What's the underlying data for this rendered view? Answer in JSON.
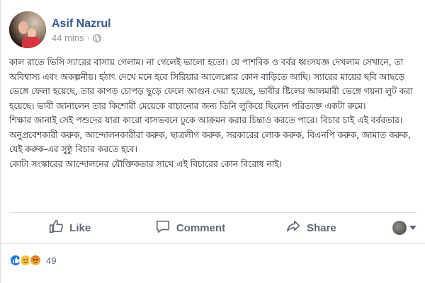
{
  "post": {
    "author": "Asif Nazrul",
    "timestamp": "44 mins",
    "separator": "·",
    "privacy_icon": "globe-icon",
    "paragraphs": [
      "কাল রাতে ভিসি স্যারের বাসায় গেলাম। না গেলেই ভালো হতো। যে পাশবিক ও বর্বর ধ্বংসযজ্ঞ দেখলাম সেখানে, তা অবিশ্বাস্য এবং অকল্পনীয়। হঠাৎ দেখে মনে হবে সিরিয়ার আলেপ্পোর কোন বাড়িতে আছি। স্যারের মায়ের ছবি আছড়ে ভেঙ্গে ফেলা হয়েছে, তার কাপড় চোপড় ছুড়ে ফেলে আগুন দেয়া হয়েছে, ভাবীর ষ্টিলের আলমারী ভেঙ্গে গয়না লুট করা হয়েছে। ভাবী জানালেন তার কিশোরী মেয়েকে বাচানোর জন্য তিনি লুকিয়ে ছিলেন পরিত্যক্ত একটা রুমে।",
      "শিক্ষার জানাই সেই পশুদের যারা কারো বাসভবনে ঢুকে আক্রমন করার চিন্তাও করতে পারে। বিচার চাই এই বর্বরতার। অনুপ্রবেশকারী করুক, আন্দোলনকারীরা করুক, ছাত্রলীগ করুক, সরকারের লোক করুক, বিএনপি করুক, জামাত করুক, যেই করুক-এর সুষ্ঠু বিচার করতে হবে।",
      "কোটা সংস্কারের আন্দোলনের যৌক্তিকতার সাথে এই বিচারের কোন বিরোধ নাই।"
    ]
  },
  "actions": {
    "like": {
      "label": "Like",
      "icon": "thumbs-up-icon"
    },
    "comment": {
      "label": "Comment",
      "icon": "comment-icon"
    },
    "share": {
      "label": "Share",
      "icon": "share-icon"
    }
  },
  "reactions": {
    "icons": [
      "like-reaction-icon",
      "sad-reaction-icon",
      "angry-reaction-icon"
    ],
    "count": "49"
  },
  "colors": {
    "author": "#365899",
    "meta": "#90949c",
    "action": "#606770",
    "like_blue": "#1877f2"
  }
}
